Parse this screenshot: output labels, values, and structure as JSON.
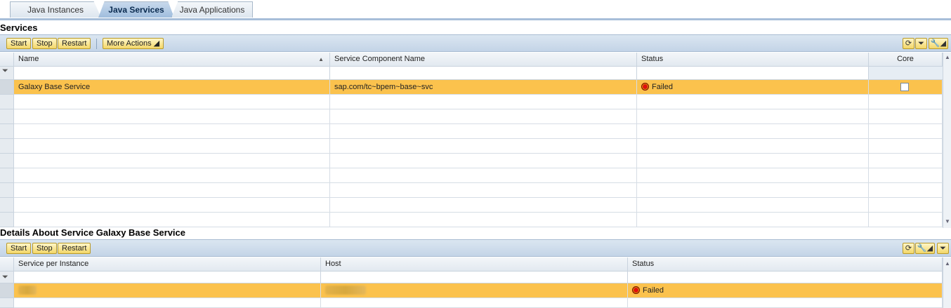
{
  "tabs": [
    {
      "label": "Java Instances",
      "active": false
    },
    {
      "label": "Java Services",
      "active": true
    },
    {
      "label": "Java Applications",
      "active": false
    }
  ],
  "services": {
    "title": "Services",
    "toolbar": {
      "start": "Start",
      "stop": "Stop",
      "restart": "Restart",
      "more_actions": "More Actions"
    },
    "columns": {
      "name": "Name",
      "component": "Service Component Name",
      "status": "Status",
      "core": "Core"
    },
    "rows": [
      {
        "name": "Galaxy Base Service",
        "component": "sap.com/tc~bpem~base~svc",
        "status": "Failed",
        "core": false,
        "selected": true
      }
    ],
    "empty_rows": 9
  },
  "details": {
    "title": "Details About Service Galaxy Base Service",
    "toolbar": {
      "start": "Start",
      "stop": "Stop",
      "restart": "Restart"
    },
    "columns": {
      "instance": "Service per Instance",
      "host": "Host",
      "status": "Status"
    },
    "rows": [
      {
        "instance": "",
        "host": "",
        "status": "Failed",
        "selected": true
      }
    ]
  },
  "colors": {
    "selected_row": "#fbc24d",
    "toolbar": "#c3d4e7",
    "button": "#f3d768",
    "failed": "#e01010"
  },
  "icons": {
    "refresh": "refresh-icon",
    "filter": "filter-icon",
    "settings": "settings-icon",
    "sort": "sort-ascending-icon"
  }
}
